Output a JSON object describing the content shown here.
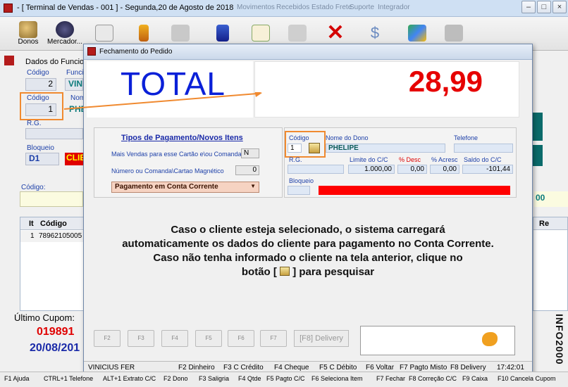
{
  "window": {
    "title": "- [ Terminal de Vendas - 001 ] - Segunda,20 de Agosto de 2018",
    "ghost_menu": [
      "Movimentos",
      "Recebidos",
      "Estado Frete",
      "Suporte",
      "Integrador"
    ]
  },
  "toolbar": {
    "donos_label": "Donos",
    "mercador_label": "Mercador..."
  },
  "bg_form": {
    "section_label": "Dados do Funcion",
    "codigo_label": "Código",
    "codigo_value": "2",
    "funcionario_label": "Funcio",
    "funcionario_value": "VIN",
    "codigo2_label": "Código",
    "codigo2_value": "1",
    "nome_label": "Nom",
    "nome_value": "PHE",
    "rg_label": "R.G.",
    "bloqueio_label": "Bloqueio",
    "bloqueio_value": "D1",
    "cli_value": "CLIE",
    "codigo_input_label": "Código:",
    "items_header_it": "It",
    "items_header_codigo": "Código",
    "items_header_re": "Re",
    "item_row_it": "1",
    "item_row_codigo": "78962105005",
    "right_value": "00",
    "ultimo_cupom_label": "Último Cupom:",
    "ultimo_cupom_num": "019891",
    "ultimo_cupom_date": "20/08/201",
    "vertical_brand": "INFO2000"
  },
  "dialog": {
    "title": "Fechamento do Pedido",
    "total_label": "TOTAL",
    "total_value": "28,99",
    "payment": {
      "title": "Tipos de Pagamento/Novos Itens",
      "q1": "Mais Vendas para esse Cartão e\\ou Comanda ?",
      "q1_value": "N",
      "q2": "Número ou Comanda\\Cartao Magnético",
      "q2_value": "0",
      "selected": "Pagamento em Conta Corrente"
    },
    "client": {
      "codigo_label": "Código",
      "codigo_value": "1",
      "nome_label": "Nome do Dono",
      "nome_value": "PHELIPE",
      "telefone_label": "Telefone",
      "rg_label": "R.G.",
      "limite_label": "Limite do C/C",
      "limite_value": "1.000,00",
      "desc_label": "% Desc",
      "desc_value": "0,00",
      "acresc_label": "% Acresc",
      "acresc_value": "0,00",
      "saldo_label": "Saldo do C/C",
      "saldo_value": "-101,44",
      "bloqueio_label": "Bloqueio"
    },
    "message_lines": [
      "Caso o cliente esteja selecionado, o sistema carregará",
      "automaticamente os dados do cliente para pagamento no Conta Corrente.",
      "Caso não tenha informado o cliente na tela anterior, clique no"
    ],
    "message_last_pre": "botão [",
    "message_last_post": "] para pesquisar",
    "fkeys": [
      "F2",
      "F3",
      "F4",
      "F5",
      "F6",
      "F7"
    ],
    "delivery_label": "[F8] Delivery",
    "status": {
      "user": "VINICIUS FER",
      "f2": "F2 Dinheiro",
      "f3": "F3 C Crédito",
      "f4": "F4 Cheque",
      "f5": "F5 C Débito",
      "f6": "F6 Voltar",
      "f7": "F7 Pagto Misto",
      "f8": "F8 Delivery",
      "time": "17:42:01"
    }
  },
  "bottombar": {
    "items": [
      "F1 Ajuda",
      "CTRL+1 Telefone",
      "ALT+1 Extrato C/C",
      "F2 Dono",
      "F3 Saligria",
      "F4 Qtde",
      "F5 Pagto C/C",
      "F6 Seleciona Item",
      "F7 Fechar",
      "F8 Correção C/C",
      "F9 Caixa",
      "F10 Cancela Cupom"
    ]
  },
  "colors": {
    "total_label": "#0a20d8",
    "total_value": "#e60000",
    "annotation": "#f08a30",
    "bloqueio_bar": "#ff0000"
  }
}
